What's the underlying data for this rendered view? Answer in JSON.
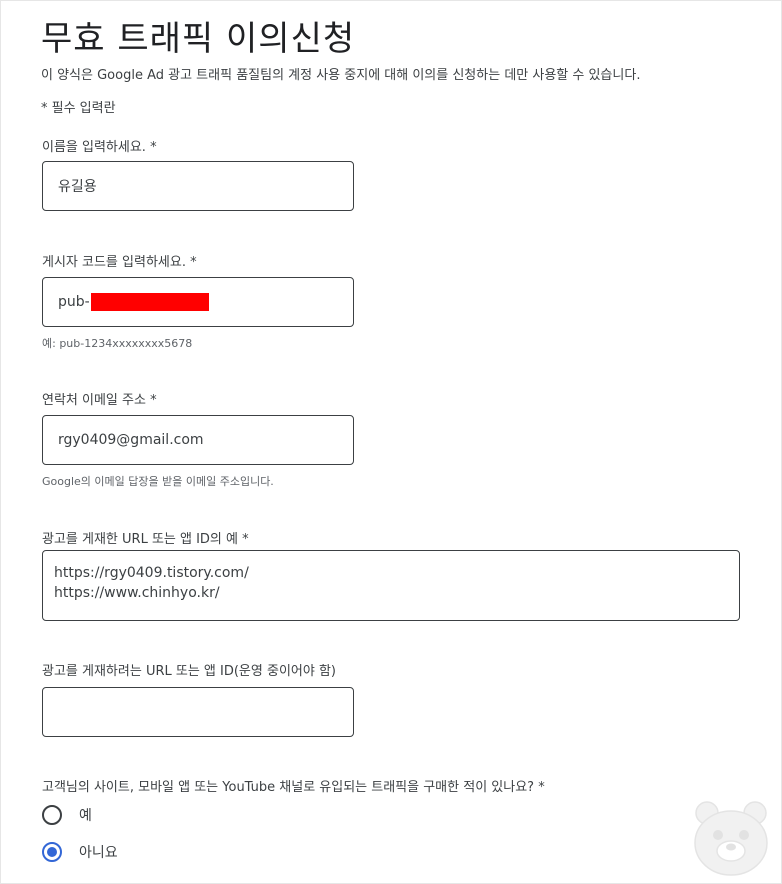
{
  "form": {
    "title": "무효 트래픽 이의신청",
    "description": "이 양식은 Google Ad 광고 트래픽 품질팀의 계정 사용 중지에 대해 이의를 신청하는 데만 사용할 수 있습니다.",
    "required_note": "* 필수 입력란"
  },
  "fields": {
    "name": {
      "label": "이름을 입력하세요. *",
      "value": "유길용"
    },
    "publisher_code": {
      "label": "게시자 코드를 입력하세요. *",
      "value_prefix": "pub-",
      "helper": "예: pub-1234xxxxxxxx5678"
    },
    "email": {
      "label": "연락처 이메일 주소 *",
      "value": "rgy0409@gmail.com",
      "helper": "Google의 이메일 답장을 받을 이메일 주소입니다."
    },
    "published_urls": {
      "label": "광고를 게재한 URL 또는 앱 ID의 예 *",
      "lines": [
        "https://rgy0409.tistory.com/",
        "https://www.chinhyo.kr/"
      ]
    },
    "planned_url": {
      "label": "광고를 게재하려는 URL 또는 앱 ID(운영 중이어야 함)",
      "value": ""
    },
    "purchased_traffic": {
      "question": "고객님의 사이트, 모바일 앱 또는 YouTube 채널로 유입되는 트래픽을 구매한 적이 있나요? *",
      "options": [
        {
          "label": "예",
          "checked": false
        },
        {
          "label": "아니요",
          "checked": true
        }
      ]
    }
  },
  "colors": {
    "radio_selected": "#3367d6",
    "redaction": "#ff0000"
  },
  "icons": {
    "mascot": "bear-face-watermark-icon"
  }
}
